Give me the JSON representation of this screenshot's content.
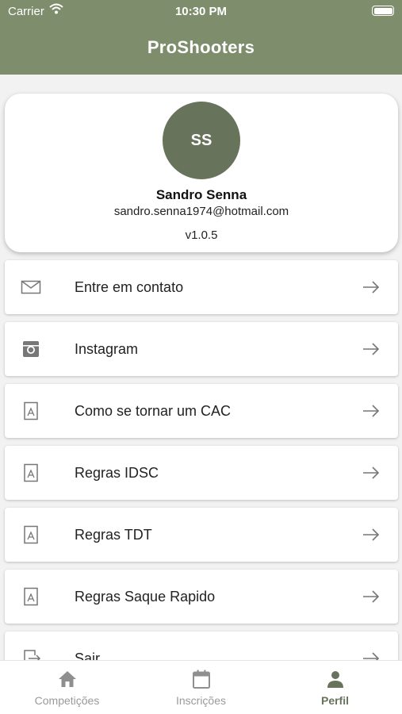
{
  "status_bar": {
    "carrier": "Carrier",
    "time": "10:30 PM"
  },
  "header": {
    "title": "ProShooters"
  },
  "profile": {
    "initials": "SS",
    "name": "Sandro Senna",
    "email": "sandro.senna1974@hotmail.com",
    "version": "v1.0.5"
  },
  "menu": {
    "items": [
      {
        "label": "Entre em contato",
        "icon": "mail-icon"
      },
      {
        "label": "Instagram",
        "icon": "instagram-icon"
      },
      {
        "label": "Como se tornar um CAC",
        "icon": "pdf-icon"
      },
      {
        "label": "Regras IDSC",
        "icon": "pdf-icon"
      },
      {
        "label": "Regras TDT",
        "icon": "pdf-icon"
      },
      {
        "label": "Regras Saque Rapido",
        "icon": "pdf-icon"
      },
      {
        "label": "Sair",
        "icon": "logout-icon"
      }
    ]
  },
  "bottom_nav": {
    "items": [
      {
        "label": "Competições",
        "icon": "home-icon",
        "active": false
      },
      {
        "label": "Inscrições",
        "icon": "calendar-icon",
        "active": false
      },
      {
        "label": "Perfil",
        "icon": "person-icon",
        "active": true
      }
    ]
  },
  "colors": {
    "primary": "#7e8d6c",
    "avatar": "#67735a",
    "background": "#f2f2f2"
  }
}
